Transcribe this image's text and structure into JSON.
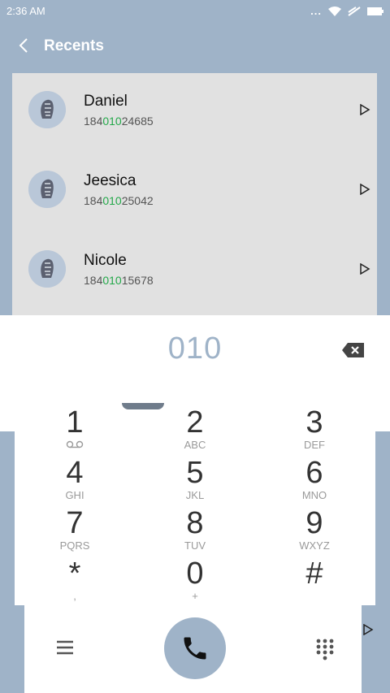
{
  "status_bar": {
    "time": "2:36 AM",
    "more": "..."
  },
  "header": {
    "title": "Recents"
  },
  "recents": [
    {
      "name": "Daniel",
      "number_prefix": "184",
      "number_match": "010",
      "number_suffix": "24685"
    },
    {
      "name": "Jeesica",
      "number_prefix": "184",
      "number_match": "010",
      "number_suffix": "25042"
    },
    {
      "name": "Nicole",
      "number_prefix": "184",
      "number_match": "010",
      "number_suffix": "15678"
    }
  ],
  "dialpad": {
    "input": "010",
    "keys": [
      {
        "digit": "1",
        "letters": "voicemail"
      },
      {
        "digit": "2",
        "letters": "ABC"
      },
      {
        "digit": "3",
        "letters": "DEF"
      },
      {
        "digit": "4",
        "letters": "GHI"
      },
      {
        "digit": "5",
        "letters": "JKL"
      },
      {
        "digit": "6",
        "letters": "MNO"
      },
      {
        "digit": "7",
        "letters": "PQRS"
      },
      {
        "digit": "8",
        "letters": "TUV"
      },
      {
        "digit": "9",
        "letters": "WXYZ"
      },
      {
        "digit": "*",
        "letters": ","
      },
      {
        "digit": "0",
        "letters": "+"
      },
      {
        "digit": "#",
        "letters": ""
      }
    ]
  },
  "colors": {
    "accent": "#9fb3c8",
    "highlight": "#24a84a",
    "panel": "#e1e1e1"
  },
  "icons": [
    "back-icon",
    "wifi-icon",
    "signal-icon",
    "battery-icon",
    "play-icon",
    "backspace-icon",
    "menu-icon",
    "phone-icon",
    "keypad-icon"
  ]
}
